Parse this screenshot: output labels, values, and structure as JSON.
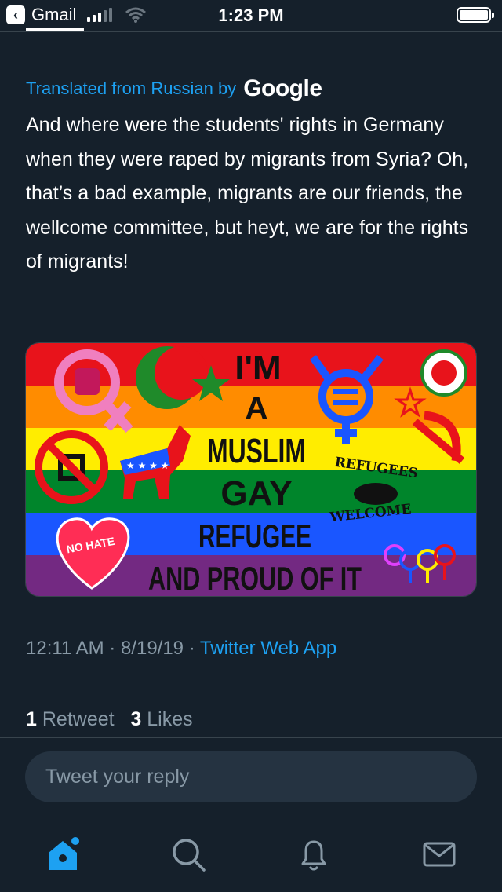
{
  "status_bar": {
    "carrier": "Gmail",
    "time": "1:23 PM"
  },
  "tweet": {
    "translated_label": "Translated from Russian by",
    "translated_brand": "Google",
    "text": "And where were the students' rights in Germany when they were raped by migrants from Syria? Oh, that’s a bad example, migrants are our friends, the wellcome committee, but heyt, we are for the rights of migrants!",
    "timestamp": "12:11 AM · 8/19/19 · ",
    "source_app": "Twitter Web App",
    "retweet_count": "1",
    "retweet_label": "Retweet",
    "like_count": "3",
    "like_label": "Likes"
  },
  "image": {
    "line1": "I'M",
    "line2": "A",
    "line3": "MUSLIM",
    "line4": "GAY",
    "line5": "REFUGEE",
    "line6": "AND PROUD OF IT",
    "no_hate": "NO HATE",
    "refugees": "REFUGEES",
    "welcome": "WELCOME",
    "stripe_colors": [
      "#e8131b",
      "#ff8c00",
      "#ffed00",
      "#00852b",
      "#1a56ff",
      "#732982"
    ]
  },
  "reply": {
    "placeholder": "Tweet your reply"
  },
  "tabs": [
    {
      "icon": "home-icon",
      "active": true
    },
    {
      "icon": "search-icon",
      "active": false
    },
    {
      "icon": "bell-icon",
      "active": false
    },
    {
      "icon": "mail-icon",
      "active": false
    }
  ],
  "colors": {
    "background": "#15202b",
    "accent": "#1da1f2",
    "secondary_text": "#8899a6",
    "reply_field": "#253341"
  }
}
